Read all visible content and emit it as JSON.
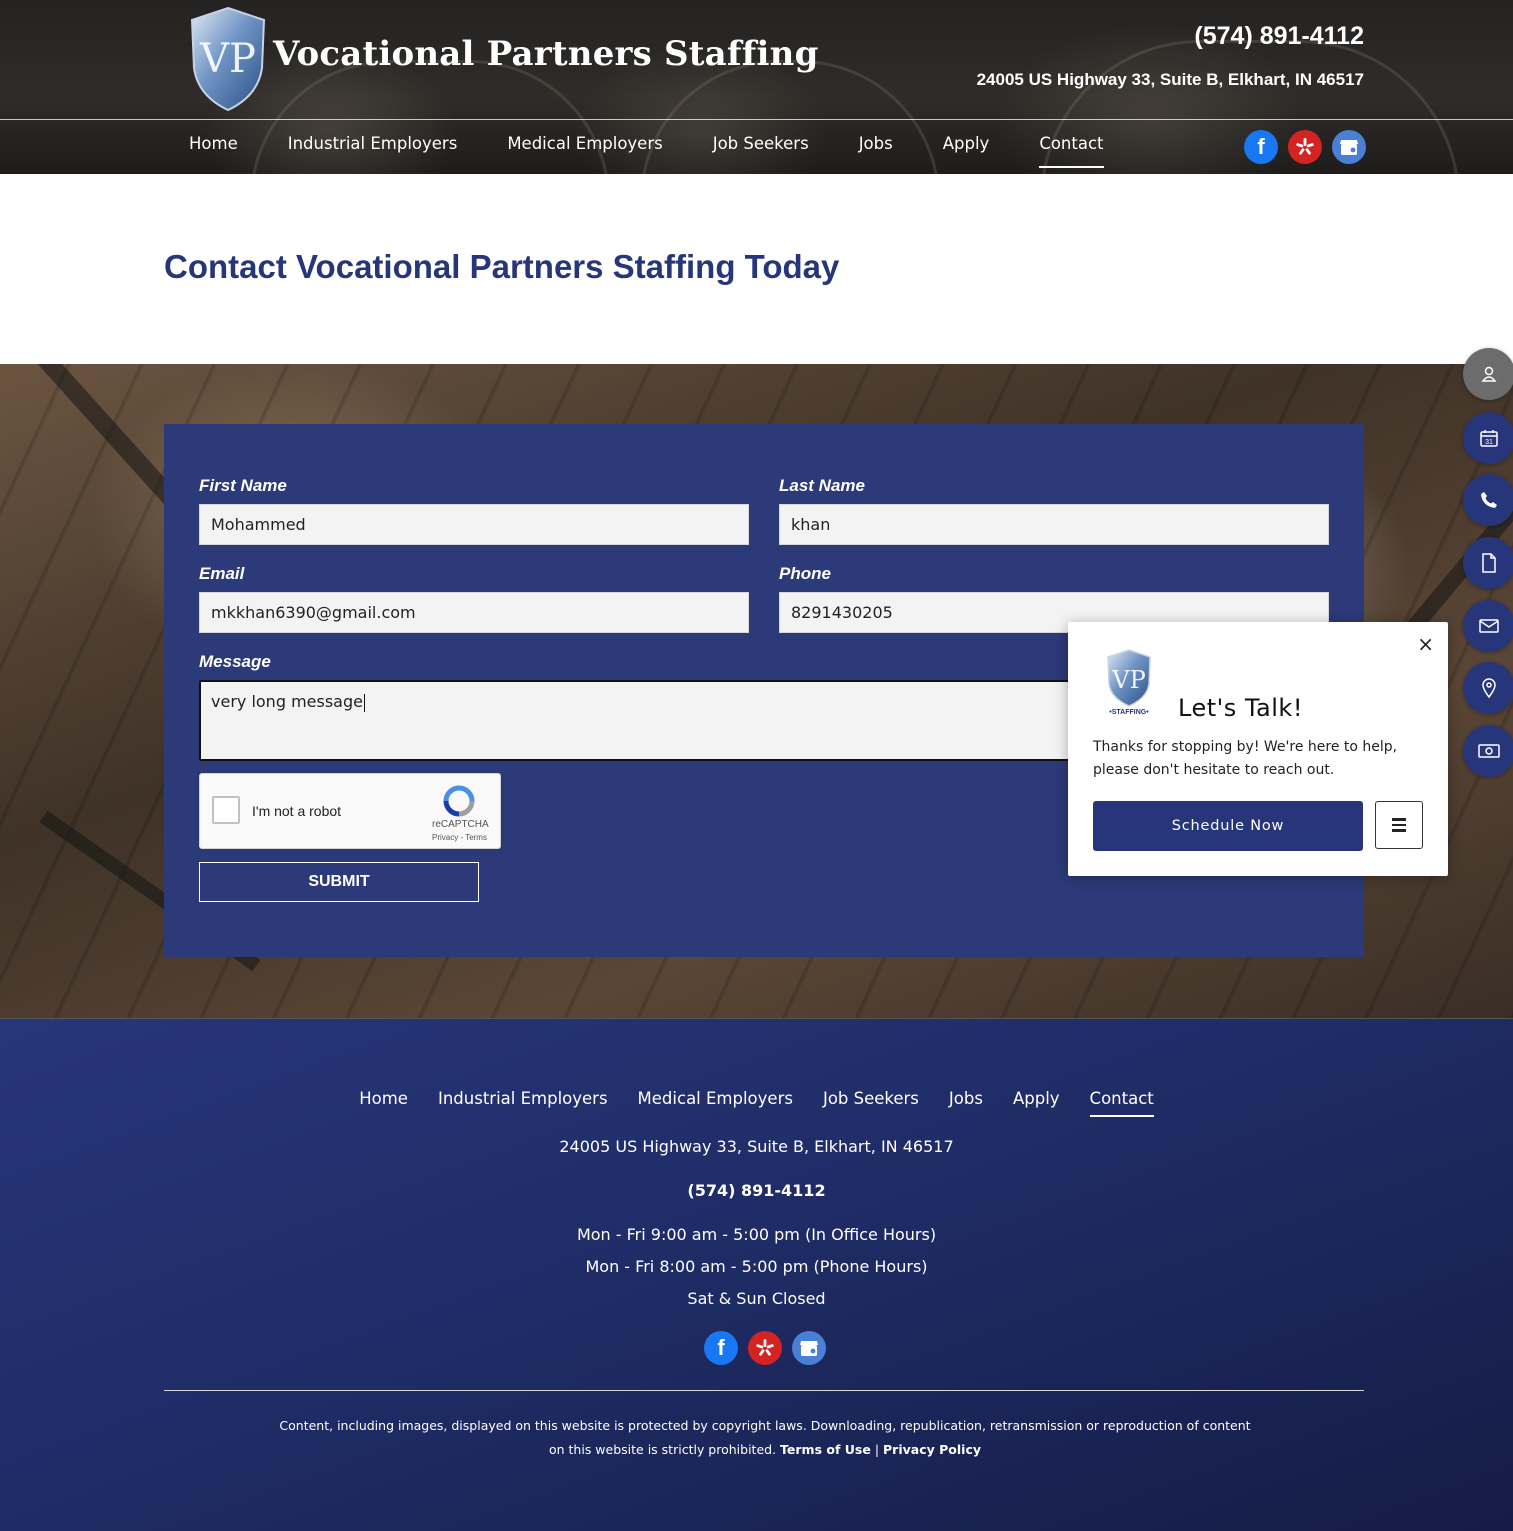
{
  "header": {
    "brand": "Vocational Partners Staffing",
    "phone": "(574) 891-4112",
    "address": "24005 US Highway 33, Suite B, Elkhart, IN 46517"
  },
  "nav": {
    "items": [
      "Home",
      "Industrial Employers",
      "Medical Employers",
      "Job Seekers",
      "Jobs",
      "Apply",
      "Contact"
    ],
    "active": "Contact"
  },
  "social_icons": [
    "facebook-icon",
    "yelp-icon",
    "google-business-icon"
  ],
  "page": {
    "title": "Contact Vocational Partners Staffing Today"
  },
  "form": {
    "first_name_label": "First Name",
    "first_name_value": "Mohammed",
    "last_name_label": "Last Name",
    "last_name_value": "khan",
    "email_label": "Email",
    "email_value": "mkkhan6390@gmail.com",
    "phone_label": "Phone",
    "phone_value": "8291430205",
    "message_label": "Message",
    "message_value": "very long message",
    "captcha_label": "I'm not a robot",
    "captcha_brand": "reCAPTCHA",
    "captcha_links": "Privacy - Terms",
    "submit_label": "SUBMIT"
  },
  "popup": {
    "logo_text": "•STAFFING•",
    "title": "Let's Talk!",
    "text": "Thanks for stopping by! We're here to help, please don't hesitate to reach out.",
    "button": "Schedule Now",
    "close": "×"
  },
  "floating_bar": [
    "user-icon",
    "calendar-icon",
    "phone-icon",
    "document-icon",
    "mail-icon",
    "location-pin-icon",
    "payment-icon"
  ],
  "footer": {
    "nav": [
      "Home",
      "Industrial Employers",
      "Medical Employers",
      "Job Seekers",
      "Jobs",
      "Apply",
      "Contact"
    ],
    "address": "24005 US Highway 33, Suite B, Elkhart, IN 46517",
    "phone": "(574) 891-4112",
    "hours_office": "Mon - Fri 9:00 am - 5:00 pm (In Office Hours)",
    "hours_phone": "Mon - Fri 8:00 am - 5:00 pm (Phone Hours)",
    "hours_weekend": "Sat & Sun Closed",
    "copyright": "Content, including images, displayed on this website is protected by copyright laws. Downloading, republication, retransmission or reproduction of content on this website is strictly prohibited.",
    "terms": "Terms of Use",
    "separator": "|",
    "privacy": "Privacy Policy"
  },
  "colors": {
    "brand_navy": "#27367a",
    "form_card": "#2c3a7a",
    "facebook": "#1877f2",
    "yelp": "#d32323",
    "google_business": "#4a7fd6"
  }
}
